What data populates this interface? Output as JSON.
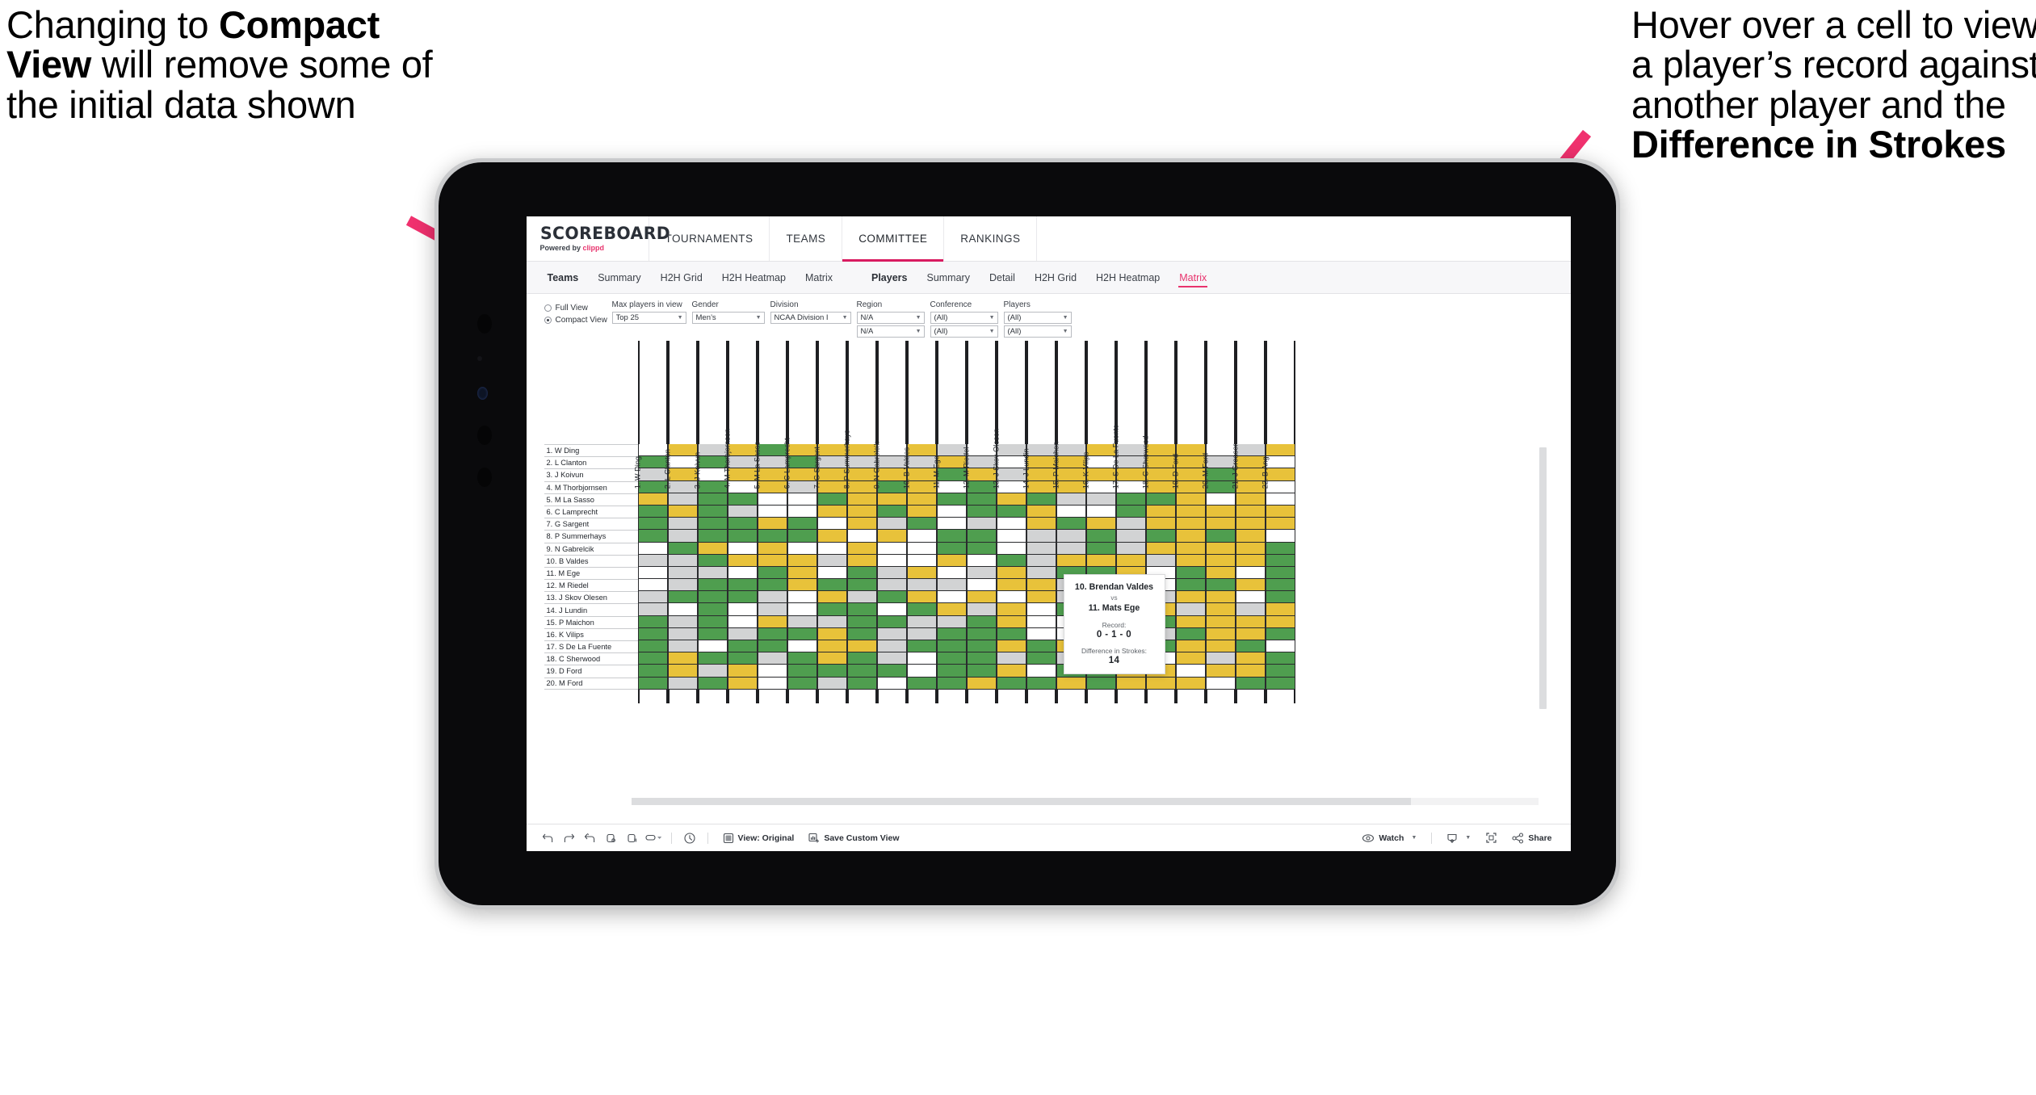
{
  "annotations": {
    "left": {
      "pre": "Changing to ",
      "bold": "Compact View",
      "post": " will remove some of the initial data shown"
    },
    "right": {
      "pre": "Hover over a cell to view a player’s record against another player and the ",
      "bold": "Difference in Strokes",
      "post": ""
    }
  },
  "brand": {
    "word": "SCOREBOARD",
    "powered": "Powered by ",
    "vendor": "clippd"
  },
  "topnav": {
    "items": [
      "TOURNAMENTS",
      "TEAMS",
      "COMMITTEE",
      "RANKINGS"
    ],
    "active": "COMMITTEE"
  },
  "subnav": {
    "teams_label": "Teams",
    "teams_items": [
      "Summary",
      "H2H Grid",
      "H2H Heatmap",
      "Matrix"
    ],
    "players_label": "Players",
    "players_items": [
      "Summary",
      "Detail",
      "H2H Grid",
      "H2H Heatmap",
      "Matrix"
    ],
    "active": "Matrix"
  },
  "filters": {
    "view_mode": {
      "full": "Full View",
      "compact": "Compact View",
      "selected": "Compact View"
    },
    "max_players": {
      "label": "Max players in view",
      "value": "Top 25"
    },
    "gender": {
      "label": "Gender",
      "value": "Men’s"
    },
    "division": {
      "label": "Division",
      "value": "NCAA Division I"
    },
    "region": {
      "label": "Region",
      "value1": "N/A",
      "value2": "N/A"
    },
    "conference": {
      "label": "Conference",
      "value1": "(All)",
      "value2": "(All)"
    },
    "players": {
      "label": "Players",
      "value1": "(All)",
      "value2": "(All)"
    }
  },
  "matrix": {
    "row_labels": [
      "1. W Ding",
      "2. L Clanton",
      "3. J Koivun",
      "4. M Thorbjornsen",
      "5. M La Sasso",
      "6. C Lamprecht",
      "7. G Sargent",
      "8. P Summerhays",
      "9. N Gabrelcik",
      "10. B Valdes",
      "11. M Ege",
      "12. M Riedel",
      "13. J Skov Olesen",
      "14. J Lundin",
      "15. P Maichon",
      "16. K Vilips",
      "17. S De La Fuente",
      "18. C Sherwood",
      "19. D Ford",
      "20. M Ford"
    ],
    "col_labels": [
      "1. W Ding",
      "2. L Clanton",
      "3. J Koivun",
      "4. M Thorbjornsen",
      "5. M La Sasso",
      "6. C Lamprecht",
      "7. G Sargent",
      "8. P Summerhays",
      "9. N Gabrelcik",
      "10. B Valdes",
      "11. M Ege",
      "12. M Riedel",
      "13. J Skov Olesen",
      "14. J Lundin",
      "15. P Maichon",
      "16. K Vilips",
      "17. S De La Fuente",
      "18. C Sherwood",
      "19. D Ford",
      "20. M Ford",
      "21. J Greaser",
      "22. B Ang"
    ],
    "legend_colors": {
      "win": "#4f9e4f",
      "tie": "#e8c23a",
      "loss": "#d2d3d4",
      "none": "#ffffff"
    },
    "cells": [
      [
        "w",
        "y",
        "a",
        "y",
        "g",
        "y",
        "y",
        "y",
        "w",
        "y",
        "a",
        "w",
        "a",
        "a",
        "a",
        "y",
        "a",
        "y",
        "y",
        "w",
        "a",
        "y"
      ],
      [
        "g",
        "w",
        "g",
        "a",
        "a",
        "g",
        "a",
        "a",
        "a",
        "a",
        "y",
        "a",
        "w",
        "y",
        "y",
        "w",
        "a",
        "y",
        "y",
        "a",
        "y",
        "w"
      ],
      [
        "a",
        "y",
        "w",
        "y",
        "y",
        "y",
        "y",
        "y",
        "y",
        "y",
        "g",
        "y",
        "a",
        "y",
        "y",
        "y",
        "y",
        "y",
        "y",
        "g",
        "y",
        "y"
      ],
      [
        "g",
        "a",
        "g",
        "w",
        "y",
        "a",
        "y",
        "y",
        "g",
        "y",
        "w",
        "g",
        "w",
        "y",
        "y",
        "w",
        "w",
        "y",
        "y",
        "g",
        "y",
        "w"
      ],
      [
        "y",
        "a",
        "g",
        "g",
        "w",
        "w",
        "g",
        "y",
        "y",
        "y",
        "g",
        "g",
        "y",
        "g",
        "a",
        "a",
        "g",
        "g",
        "y",
        "w",
        "y",
        "w"
      ],
      [
        "g",
        "y",
        "g",
        "a",
        "w",
        "w",
        "y",
        "y",
        "g",
        "y",
        "w",
        "g",
        "g",
        "y",
        "w",
        "w",
        "g",
        "y",
        "y",
        "y",
        "y",
        "y"
      ],
      [
        "g",
        "a",
        "g",
        "g",
        "y",
        "g",
        "w",
        "y",
        "a",
        "g",
        "w",
        "a",
        "w",
        "y",
        "g",
        "y",
        "a",
        "y",
        "y",
        "y",
        "y",
        "y"
      ],
      [
        "g",
        "a",
        "g",
        "g",
        "g",
        "g",
        "y",
        "w",
        "y",
        "w",
        "g",
        "g",
        "w",
        "a",
        "a",
        "g",
        "a",
        "g",
        "y",
        "g",
        "y",
        "w"
      ],
      [
        "w",
        "g",
        "y",
        "w",
        "y",
        "w",
        "w",
        "y",
        "w",
        "w",
        "g",
        "g",
        "w",
        "a",
        "a",
        "g",
        "a",
        "y",
        "y",
        "y",
        "y",
        "g"
      ],
      [
        "a",
        "a",
        "g",
        "y",
        "y",
        "y",
        "a",
        "y",
        "w",
        "w",
        "y",
        "w",
        "g",
        "a",
        "y",
        "y",
        "y",
        "a",
        "y",
        "y",
        "y",
        "g"
      ],
      [
        "w",
        "a",
        "a",
        "w",
        "g",
        "y",
        "w",
        "g",
        "a",
        "y",
        "w",
        "a",
        "y",
        "a",
        "g",
        "g",
        "y",
        "w",
        "g",
        "y",
        "w",
        "g"
      ],
      [
        "w",
        "a",
        "g",
        "g",
        "g",
        "y",
        "g",
        "g",
        "a",
        "a",
        "a",
        "w",
        "y",
        "y",
        "a",
        "y",
        "y",
        "w",
        "g",
        "g",
        "y",
        "g"
      ],
      [
        "a",
        "g",
        "g",
        "g",
        "a",
        "w",
        "y",
        "a",
        "g",
        "y",
        "w",
        "y",
        "w",
        "y",
        "a",
        "y",
        "g",
        "a",
        "y",
        "y",
        "w",
        "g"
      ],
      [
        "a",
        "w",
        "g",
        "w",
        "a",
        "w",
        "g",
        "g",
        "w",
        "g",
        "y",
        "a",
        "y",
        "w",
        "g",
        "y",
        "a",
        "y",
        "a",
        "y",
        "a",
        "y"
      ],
      [
        "g",
        "a",
        "g",
        "w",
        "y",
        "a",
        "a",
        "g",
        "g",
        "a",
        "a",
        "g",
        "y",
        "w",
        "w",
        "g",
        "y",
        "g",
        "y",
        "y",
        "y",
        "y"
      ],
      [
        "g",
        "a",
        "g",
        "a",
        "g",
        "g",
        "y",
        "g",
        "a",
        "a",
        "g",
        "g",
        "g",
        "w",
        "w",
        "w",
        "y",
        "a",
        "g",
        "y",
        "y",
        "g"
      ],
      [
        "g",
        "a",
        "w",
        "g",
        "g",
        "w",
        "y",
        "y",
        "a",
        "g",
        "g",
        "g",
        "y",
        "g",
        "y",
        "w",
        "w",
        "g",
        "y",
        "y",
        "g",
        "w"
      ],
      [
        "g",
        "y",
        "g",
        "g",
        "a",
        "g",
        "y",
        "g",
        "a",
        "w",
        "g",
        "g",
        "a",
        "g",
        "a",
        "a",
        "g",
        "w",
        "y",
        "a",
        "y",
        "g"
      ],
      [
        "g",
        "y",
        "a",
        "y",
        "w",
        "g",
        "g",
        "g",
        "g",
        "w",
        "g",
        "g",
        "y",
        "w",
        "g",
        "g",
        "y",
        "y",
        "w",
        "y",
        "y",
        "g"
      ],
      [
        "g",
        "a",
        "g",
        "y",
        "w",
        "g",
        "a",
        "g",
        "w",
        "g",
        "g",
        "y",
        "g",
        "g",
        "y",
        "g",
        "y",
        "y",
        "y",
        "w",
        "g",
        "g"
      ]
    ]
  },
  "tooltip": {
    "player_a": "10. Brendan Valdes",
    "vs": "vs",
    "player_b": "11. Mats Ege",
    "record_label": "Record:",
    "record_value": "0 - 1 - 0",
    "diff_label": "Difference in Strokes:",
    "diff_value": "14"
  },
  "toolbar": {
    "icons": [
      "undo-icon",
      "redo-icon",
      "revert-icon",
      "refresh-icon",
      "pause-icon",
      "highlight-icon"
    ],
    "view_label": "View: Original",
    "save_label": "Save Custom View",
    "watch_label": "Watch",
    "share_label": "Share"
  }
}
